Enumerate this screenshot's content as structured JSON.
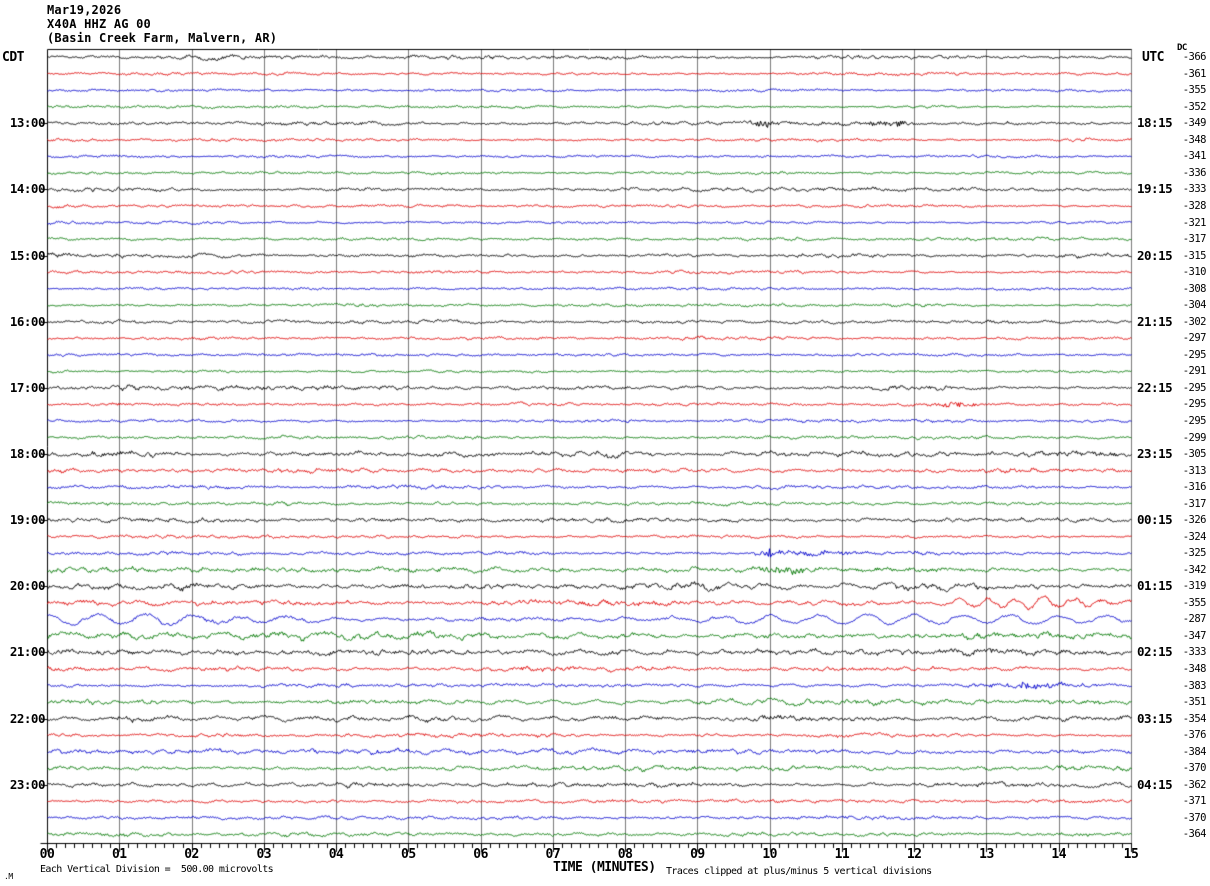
{
  "title": {
    "date": "Mar19,2026",
    "station": "X40A HHZ AG 00",
    "location": "(Basin Creek Farm, Malvern, AR)"
  },
  "axes": {
    "left_header": "CDT",
    "right_header": "UTC",
    "dc_header": "DC",
    "x_label": "TIME (MINUTES)",
    "x_ticks": [
      "00",
      "01",
      "02",
      "03",
      "04",
      "05",
      "06",
      "07",
      "08",
      "09",
      "10",
      "11",
      "12",
      "13",
      "14",
      "15"
    ]
  },
  "footer": {
    "left": "Each Vertical Division =  500.00 microvolts",
    "right": "Traces clipped at plus/minus 5 vertical divisions",
    "logo": ".M"
  },
  "chart_data": {
    "type": "line",
    "subtype": "helicorder-seismogram",
    "x_range": [
      0,
      15
    ],
    "minutes_per_line": 15,
    "vertical_division_microvolts": 500.0,
    "clip_divisions": 5,
    "grid": true,
    "grid_color": "#7a7a7a",
    "border_color": "#000000",
    "trace_colors": {
      "k": "#000000",
      "r": "#dd0000",
      "b": "#0000cc",
      "g": "#007700"
    },
    "rows": [
      {
        "cdt": "",
        "utc": "",
        "dc": -366,
        "color": "k",
        "amp": 1.7,
        "wave": 0.4,
        "events": []
      },
      {
        "cdt": "",
        "utc": "",
        "dc": -361,
        "color": "r",
        "amp": 1.2,
        "wave": 0.3,
        "events": []
      },
      {
        "cdt": "",
        "utc": "",
        "dc": -355,
        "color": "b",
        "amp": 1.2,
        "wave": 0.3,
        "events": []
      },
      {
        "cdt": "",
        "utc": "",
        "dc": -352,
        "color": "g",
        "amp": 1.1,
        "wave": 0.3,
        "events": []
      },
      {
        "cdt": "13:00",
        "utc": "18:15",
        "dc": -349,
        "color": "k",
        "amp": 1.5,
        "wave": 0.3,
        "events": [
          {
            "m": 9.9,
            "w": 0.18,
            "a": 3.2,
            "type": "fuzz"
          },
          {
            "m": 11.7,
            "w": 0.25,
            "a": 2.6,
            "type": "fuzz"
          }
        ]
      },
      {
        "cdt": "",
        "utc": "",
        "dc": -348,
        "color": "r",
        "amp": 1.3,
        "wave": 0.3,
        "events": []
      },
      {
        "cdt": "",
        "utc": "",
        "dc": -341,
        "color": "b",
        "amp": 1.1,
        "wave": 0.3,
        "events": []
      },
      {
        "cdt": "",
        "utc": "",
        "dc": -336,
        "color": "g",
        "amp": 1.2,
        "wave": 0.3,
        "events": []
      },
      {
        "cdt": "14:00",
        "utc": "19:15",
        "dc": -333,
        "color": "k",
        "amp": 1.6,
        "wave": 0.4,
        "events": []
      },
      {
        "cdt": "",
        "utc": "",
        "dc": -328,
        "color": "r",
        "amp": 1.3,
        "wave": 0.3,
        "events": []
      },
      {
        "cdt": "",
        "utc": "",
        "dc": -321,
        "color": "b",
        "amp": 1.1,
        "wave": 0.3,
        "events": []
      },
      {
        "cdt": "",
        "utc": "",
        "dc": -317,
        "color": "g",
        "amp": 1.3,
        "wave": 0.4,
        "events": []
      },
      {
        "cdt": "15:00",
        "utc": "20:15",
        "dc": -315,
        "color": "k",
        "amp": 1.6,
        "wave": 0.4,
        "events": []
      },
      {
        "cdt": "",
        "utc": "",
        "dc": -310,
        "color": "r",
        "amp": 1.3,
        "wave": 0.3,
        "events": []
      },
      {
        "cdt": "",
        "utc": "",
        "dc": -308,
        "color": "b",
        "amp": 1.1,
        "wave": 0.3,
        "events": []
      },
      {
        "cdt": "",
        "utc": "",
        "dc": -304,
        "color": "g",
        "amp": 1.2,
        "wave": 0.3,
        "events": []
      },
      {
        "cdt": "16:00",
        "utc": "21:15",
        "dc": -302,
        "color": "k",
        "amp": 1.5,
        "wave": 0.4,
        "events": []
      },
      {
        "cdt": "",
        "utc": "",
        "dc": -297,
        "color": "r",
        "amp": 1.3,
        "wave": 0.3,
        "events": []
      },
      {
        "cdt": "",
        "utc": "",
        "dc": -295,
        "color": "b",
        "amp": 1.3,
        "wave": 0.3,
        "events": []
      },
      {
        "cdt": "",
        "utc": "",
        "dc": -291,
        "color": "g",
        "amp": 1.2,
        "wave": 0.3,
        "events": []
      },
      {
        "cdt": "17:00",
        "utc": "22:15",
        "dc": -295,
        "color": "k",
        "amp": 1.9,
        "wave": 0.5,
        "events": []
      },
      {
        "cdt": "",
        "utc": "",
        "dc": -295,
        "color": "r",
        "amp": 1.3,
        "wave": 0.3,
        "events": [
          {
            "m": 12.55,
            "w": 0.25,
            "a": 2.2,
            "type": "fuzz"
          }
        ]
      },
      {
        "cdt": "",
        "utc": "",
        "dc": -295,
        "color": "b",
        "amp": 1.2,
        "wave": 0.3,
        "events": []
      },
      {
        "cdt": "",
        "utc": "",
        "dc": -299,
        "color": "g",
        "amp": 1.3,
        "wave": 0.4,
        "events": []
      },
      {
        "cdt": "18:00",
        "utc": "23:15",
        "dc": -305,
        "color": "k",
        "amp": 2.5,
        "wave": 0.8,
        "events": []
      },
      {
        "cdt": "",
        "utc": "",
        "dc": -313,
        "color": "r",
        "amp": 1.9,
        "wave": 0.5,
        "events": []
      },
      {
        "cdt": "",
        "utc": "",
        "dc": -316,
        "color": "b",
        "amp": 1.4,
        "wave": 0.4,
        "events": []
      },
      {
        "cdt": "",
        "utc": "",
        "dc": -317,
        "color": "g",
        "amp": 1.5,
        "wave": 0.5,
        "events": []
      },
      {
        "cdt": "19:00",
        "utc": "00:15",
        "dc": -326,
        "color": "k",
        "amp": 1.8,
        "wave": 0.5,
        "events": []
      },
      {
        "cdt": "",
        "utc": "",
        "dc": -324,
        "color": "r",
        "amp": 1.4,
        "wave": 0.4,
        "events": []
      },
      {
        "cdt": "",
        "utc": "",
        "dc": -325,
        "color": "b",
        "amp": 1.5,
        "wave": 0.4,
        "events": [
          {
            "m": 10.05,
            "w": 0.15,
            "a": 4.0,
            "type": "fuzz"
          },
          {
            "m": 10.6,
            "w": 0.5,
            "a": 1.5,
            "type": "fuzz"
          }
        ]
      },
      {
        "cdt": "",
        "utc": "",
        "dc": -342,
        "color": "g",
        "amp": 2.3,
        "wave": 0.7,
        "events": [
          {
            "m": 10.15,
            "w": 0.3,
            "a": 2.8,
            "type": "fuzz"
          }
        ]
      },
      {
        "cdt": "20:00",
        "utc": "01:15",
        "dc": -319,
        "color": "k",
        "amp": 3.0,
        "wave": 1.4,
        "events": []
      },
      {
        "cdt": "",
        "utc": "",
        "dc": -355,
        "color": "r",
        "amp": 2.1,
        "wave": 0.9,
        "events": [
          {
            "m": 12.9,
            "w": 0.4,
            "a": 2.5,
            "type": "wave"
          },
          {
            "m": 13.9,
            "w": 0.7,
            "a": 4.5,
            "type": "wave"
          }
        ]
      },
      {
        "cdt": "",
        "utc": "",
        "dc": -287,
        "color": "b",
        "amp": 1.6,
        "wave": 4.2,
        "events": []
      },
      {
        "cdt": "",
        "utc": "",
        "dc": -347,
        "color": "g",
        "amp": 2.3,
        "wave": 1.8,
        "events": []
      },
      {
        "cdt": "21:00",
        "utc": "02:15",
        "dc": -333,
        "color": "k",
        "amp": 2.5,
        "wave": 1.3,
        "events": []
      },
      {
        "cdt": "",
        "utc": "",
        "dc": -348,
        "color": "r",
        "amp": 1.8,
        "wave": 0.6,
        "events": []
      },
      {
        "cdt": "",
        "utc": "",
        "dc": -383,
        "color": "b",
        "amp": 1.6,
        "wave": 0.5,
        "events": [
          {
            "m": 13.55,
            "w": 0.35,
            "a": 2.8,
            "type": "fuzz"
          }
        ]
      },
      {
        "cdt": "",
        "utc": "",
        "dc": -351,
        "color": "g",
        "amp": 2.2,
        "wave": 1.6,
        "events": []
      },
      {
        "cdt": "22:00",
        "utc": "03:15",
        "dc": -354,
        "color": "k",
        "amp": 2.4,
        "wave": 1.6,
        "events": []
      },
      {
        "cdt": "",
        "utc": "",
        "dc": -376,
        "color": "r",
        "amp": 1.5,
        "wave": 0.4,
        "events": []
      },
      {
        "cdt": "",
        "utc": "",
        "dc": -384,
        "color": "b",
        "amp": 2.0,
        "wave": 1.5,
        "events": []
      },
      {
        "cdt": "",
        "utc": "",
        "dc": -370,
        "color": "g",
        "amp": 1.9,
        "wave": 0.8,
        "events": []
      },
      {
        "cdt": "23:00",
        "utc": "04:15",
        "dc": -362,
        "color": "k",
        "amp": 2.0,
        "wave": 1.0,
        "events": []
      },
      {
        "cdt": "",
        "utc": "",
        "dc": -371,
        "color": "r",
        "amp": 1.3,
        "wave": 0.4,
        "events": []
      },
      {
        "cdt": "",
        "utc": "",
        "dc": -370,
        "color": "b",
        "amp": 1.4,
        "wave": 0.4,
        "events": []
      },
      {
        "cdt": "",
        "utc": "",
        "dc": -364,
        "color": "g",
        "amp": 1.6,
        "wave": 0.5,
        "events": []
      }
    ]
  }
}
